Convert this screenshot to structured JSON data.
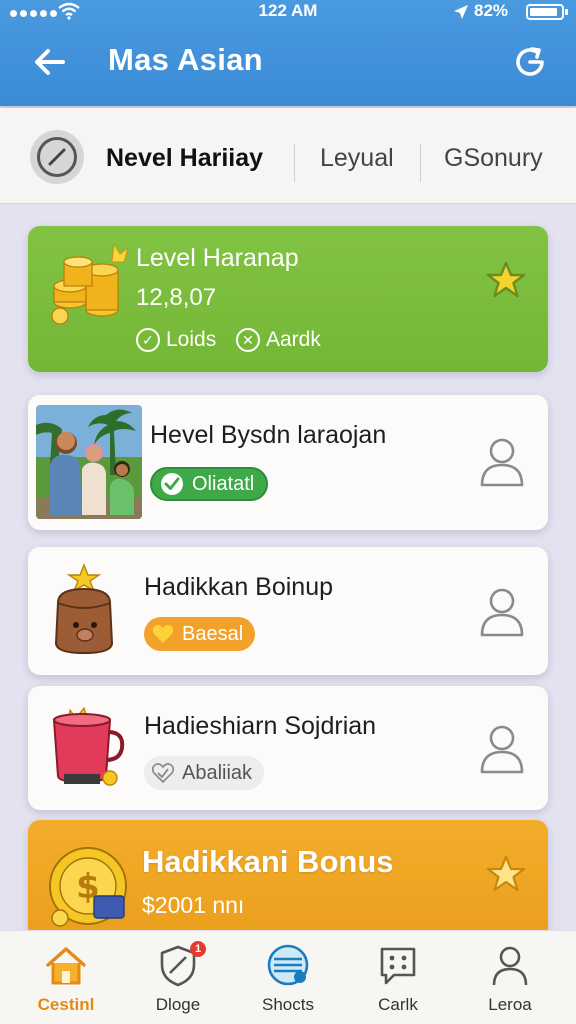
{
  "status_bar": {
    "time": "122 AM",
    "battery": "82%"
  },
  "header": {
    "title": "Mas Asian"
  },
  "tabs": {
    "active": "Nevel Hariiay",
    "second": "Leyual",
    "third": "GSonury"
  },
  "cards": {
    "level": {
      "title": "Level Haranap",
      "amount": "12,8,07",
      "meta_left": "Loids",
      "meta_right": "Aardk"
    },
    "family": {
      "title": "Hevel Bysdn laraojan",
      "badge": "Oliatatl"
    },
    "bonus1": {
      "title": "Hadikkan Boinup",
      "badge": "Baesal"
    },
    "bonus2": {
      "title": "Hadieshiarn Sojdrian",
      "badge": "Abaliiak"
    },
    "gold": {
      "title": "Hadikkani Bonus",
      "amount": "$2001 nnı"
    }
  },
  "bottom_nav": {
    "items": [
      {
        "label": "Cestinl",
        "icon": "home-icon"
      },
      {
        "label": "Dloge",
        "icon": "shield-icon"
      },
      {
        "label": "Shocts",
        "icon": "badge-icon"
      },
      {
        "label": "Carlk",
        "icon": "chat-grid-icon"
      },
      {
        "label": "Leroa",
        "icon": "profile-icon"
      }
    ],
    "notification_count": "1"
  },
  "colors": {
    "header_blue": "#3b8ad6",
    "green_card": "#7cbd3d",
    "gold_card": "#f0a825",
    "active_nav": "#e58a12"
  }
}
